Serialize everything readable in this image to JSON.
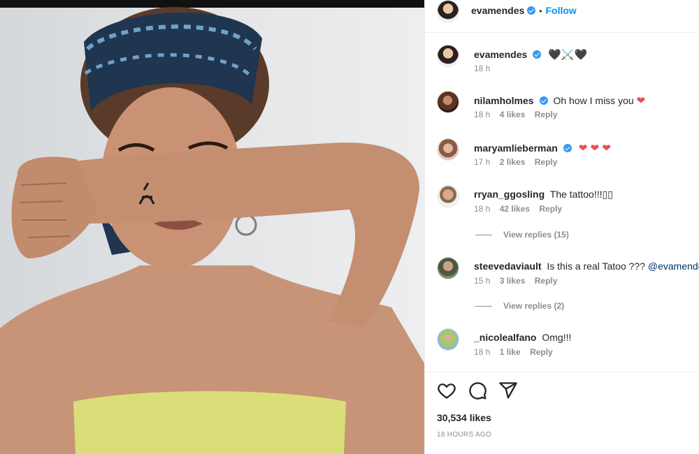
{
  "post_header": {
    "username": "evamendes",
    "separator": "•",
    "follow_label": "Follow"
  },
  "caption": {
    "username": "evamendes",
    "text": "🖤⚔️🖤",
    "time": "18 h"
  },
  "comments": [
    {
      "username": "nilamholmes",
      "verified": true,
      "text": "Oh how I miss you",
      "emoji": "❤",
      "time": "18 h",
      "likes": "4 likes",
      "reply": "Reply"
    },
    {
      "username": "maryamlieberman",
      "verified": true,
      "text": "",
      "emoji": "❤ ❤ ❤",
      "time": "17 h",
      "likes": "2 likes",
      "reply": "Reply"
    },
    {
      "username": "rryan_ggosling",
      "verified": false,
      "text": "The tattoo!!!▯▯",
      "time": "18 h",
      "likes": "42 likes",
      "reply": "Reply",
      "view_replies": "View replies (15)"
    },
    {
      "username": "steevedaviault",
      "verified": false,
      "text": "Is this a real Tatoo ???",
      "mention": "@evamendes",
      "time": "15 h",
      "likes": "3 likes",
      "reply": "Reply",
      "view_replies": "View replies (2)"
    },
    {
      "username": "_nicolealfano",
      "verified": false,
      "text": "Omg!!!",
      "time": "18 h",
      "likes": "1 like",
      "reply": "Reply"
    }
  ],
  "footer": {
    "likes": "30,534 likes",
    "time": "18 HOURS AGO"
  },
  "icons": {
    "like": "heart-outline-icon",
    "comment": "comment-bubble-icon",
    "share": "paper-plane-icon",
    "verified": "verified-badge-icon"
  },
  "colors": {
    "accent": "#0095f6",
    "verified": "#3897f0",
    "heart": "#ed4956",
    "muted": "#8e8e8e",
    "text": "#262626"
  }
}
